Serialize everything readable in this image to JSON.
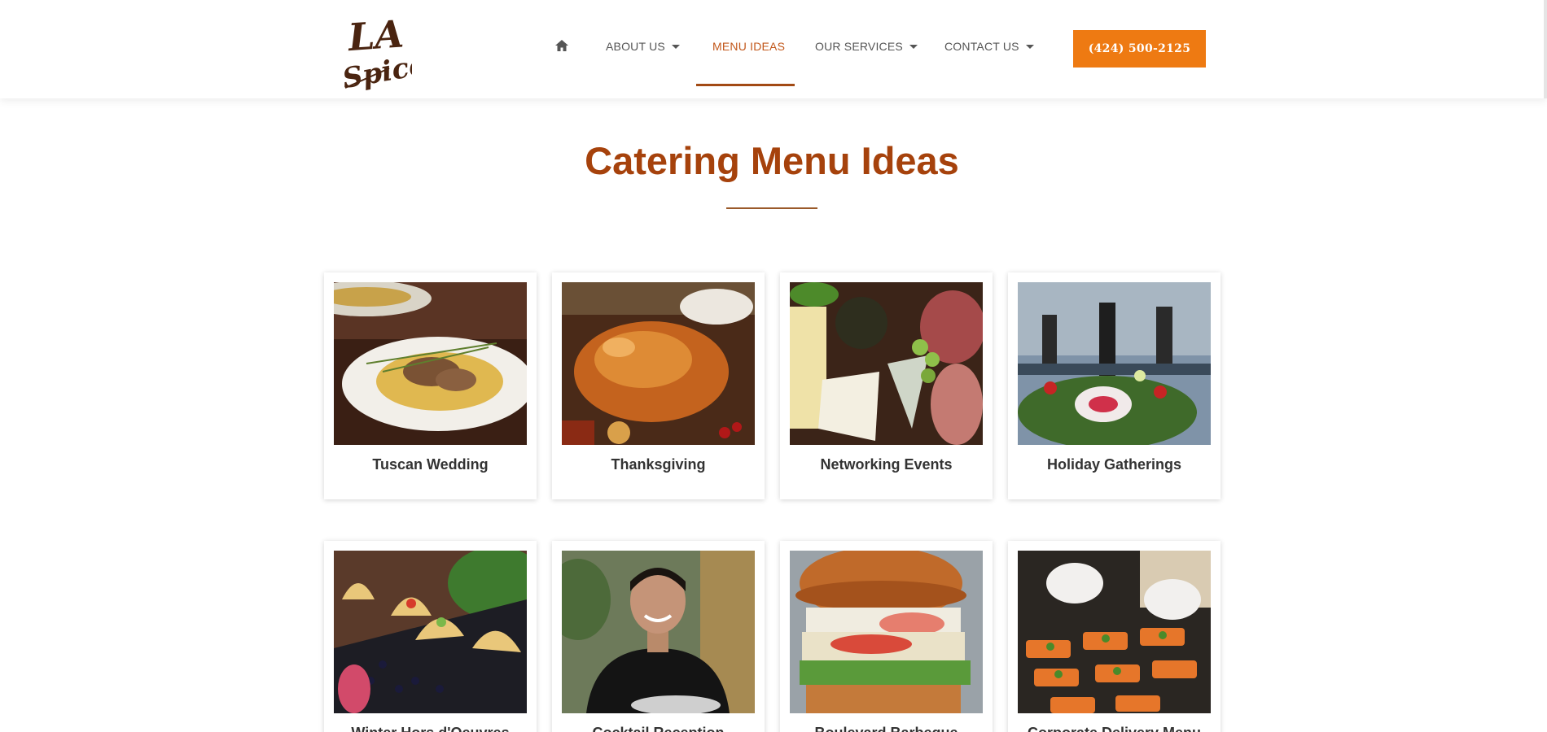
{
  "brand": {
    "logo_text_line1": "LA",
    "logo_text_line2": "Spice",
    "accent": "#ee7a12",
    "title_color": "#a6420c",
    "logo_color": "#4a2410"
  },
  "nav": {
    "home_icon": "home-icon",
    "items": [
      {
        "label": "ABOUT US",
        "has_dropdown": true
      },
      {
        "label": "MENU IDEAS",
        "has_dropdown": false,
        "active": true
      },
      {
        "label": "OUR SERVICES",
        "has_dropdown": true
      },
      {
        "label": "CONTACT US",
        "has_dropdown": true
      }
    ],
    "phone_label": "(424) 500-2125"
  },
  "page": {
    "title": "Catering Menu Ideas"
  },
  "cards": [
    {
      "label": "Tuscan Wedding",
      "image": "plate-of-pasta-photo"
    },
    {
      "label": "Thanksgiving",
      "image": "roast-turkey-photo"
    },
    {
      "label": "Networking Events",
      "image": "charcuterie-board-photo"
    },
    {
      "label": "Holiday Gatherings",
      "image": "band-and-flowers-photo"
    },
    {
      "label": "Winter Hors d'Oeuvres",
      "image": "tacos-tray-photo"
    },
    {
      "label": "Cocktail Reception",
      "image": "server-smiling-photo"
    },
    {
      "label": "Boulevard Barbeque",
      "image": "burger-photo"
    },
    {
      "label": "Corporate Delivery Menu",
      "image": "chef-plating-photo"
    }
  ]
}
